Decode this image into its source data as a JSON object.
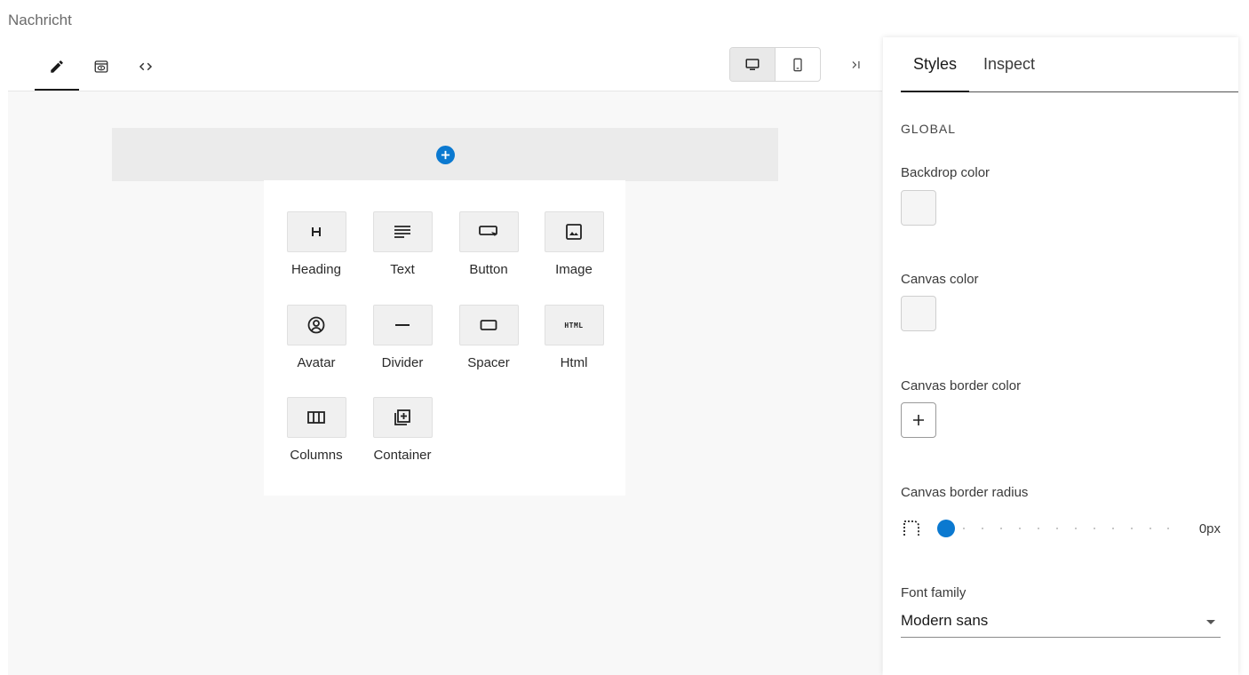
{
  "page": {
    "title": "Nachricht"
  },
  "toolbar": {
    "tabs": [
      {
        "icon": "pencil-icon",
        "active": true
      },
      {
        "icon": "preview-eye-icon",
        "active": false
      },
      {
        "icon": "code-icon",
        "active": false
      }
    ],
    "devices": [
      {
        "icon": "desktop-icon",
        "active": true
      },
      {
        "icon": "mobile-icon",
        "active": false
      }
    ],
    "collapse_icon": "collapse-panel-icon"
  },
  "canvas": {
    "add_icon": "plus-circle-icon",
    "blocks": [
      {
        "label": "Heading",
        "icon": "heading-icon"
      },
      {
        "label": "Text",
        "icon": "text-lines-icon"
      },
      {
        "label": "Button",
        "icon": "button-icon"
      },
      {
        "label": "Image",
        "icon": "image-icon"
      },
      {
        "label": "Avatar",
        "icon": "avatar-icon"
      },
      {
        "label": "Divider",
        "icon": "divider-icon"
      },
      {
        "label": "Spacer",
        "icon": "spacer-icon"
      },
      {
        "label": "Html",
        "icon": "html-icon"
      },
      {
        "label": "Columns",
        "icon": "columns-icon"
      },
      {
        "label": "Container",
        "icon": "container-icon"
      }
    ],
    "html_icon_text": "HTML"
  },
  "panel": {
    "tabs": [
      "Styles",
      "Inspect"
    ],
    "active_tab": "Styles",
    "section": "GLOBAL",
    "backdrop_label": "Backdrop color",
    "canvas_color_label": "Canvas color",
    "border_color_label": "Canvas border color",
    "border_radius_label": "Canvas border radius",
    "border_radius_value": "0px",
    "font_family_label": "Font family",
    "font_family_value": "Modern sans"
  },
  "colors": {
    "accent": "#0b79d0",
    "canvas_bg": "#f8f8f8",
    "add_bar": "#ebebeb"
  }
}
